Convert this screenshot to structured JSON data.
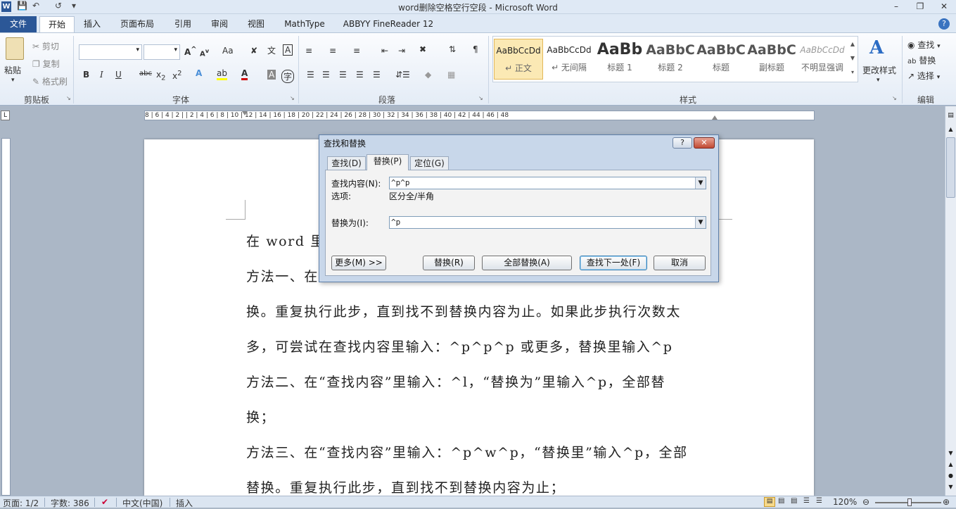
{
  "window": {
    "title": "word删除空格空行空段 - Microsoft Word"
  },
  "tabs": [
    "文件",
    "开始",
    "插入",
    "页面布局",
    "引用",
    "审阅",
    "视图",
    "MathType",
    "ABBYY FineReader 12"
  ],
  "clipboard": {
    "paste": "粘贴",
    "cut": "剪切",
    "copy": "复制",
    "format_painter": "格式刷",
    "group": "剪贴板"
  },
  "font": {
    "group": "字体",
    "aa": "Aa"
  },
  "paragraph": {
    "group": "段落"
  },
  "styles": {
    "group": "样式",
    "items": [
      {
        "sample": "AaBbCcDd",
        "name": "↵ 正文"
      },
      {
        "sample": "AaBbCcDd",
        "name": "↵ 无间隔"
      },
      {
        "sample": "AaBb",
        "name": "标题 1"
      },
      {
        "sample": "AaBbC",
        "name": "标题 2"
      },
      {
        "sample": "AaBbC",
        "name": "标题"
      },
      {
        "sample": "AaBbC",
        "name": "副标题"
      },
      {
        "sample": "AaBbCcDd",
        "name": "不明显强调"
      }
    ],
    "change_styles": "更改样式"
  },
  "editing": {
    "group": "编辑",
    "find": "查找",
    "replace": "替换",
    "select": "选择"
  },
  "ruler": {
    "numbers": "8 | 6 | 4 | 2 |   | 2 | 4 | 6 | 8 | 10 | 12 | 14 | 16 | 18 | 20 | 22 | 24 | 26 | 28 | 30 | 32 | 34 | 36 | 38 | 40 | 42 | 44 | 46 | 48"
  },
  "document": {
    "lines": [
      "在 word 里",
      "方法一、在",
      "换。重复执行此步，直到找不到替换内容为止。如果此步执行次数太",
      "多，可尝试在查找内容里输入：^p^p^p 或更多，替换里输入^p",
      "方法二、在“查找内容”里输入：^l，“替换为”里输入^p，全部替",
      "换；",
      "方法三、在“查找内容”里输入：^p^w^p，“替换里”输入^p，全部",
      "替换。重复执行此步，直到找不到替换内容为止；"
    ]
  },
  "dialog": {
    "title": "查找和替换",
    "help": "?",
    "tabs": [
      "查找(D)",
      "替换(P)",
      "定位(G)"
    ],
    "find_label": "查找内容(N):",
    "find_value": "^p^p",
    "options_label": "选项:",
    "options_value": "区分全/半角",
    "replace_label": "替换为(I):",
    "replace_value": "^p",
    "buttons": {
      "more": "更多(M) >>",
      "replace": "替换(R)",
      "replace_all": "全部替换(A)",
      "find_next": "查找下一处(F)",
      "cancel": "取消"
    }
  },
  "status": {
    "page": "页面: 1/2",
    "words": "字数: 386",
    "language": "中文(中国)",
    "mode": "插入",
    "zoom": "120%"
  },
  "colors": {
    "file_tab": "#2b5797",
    "font_color": "#d00000",
    "highlight": "#ffff00"
  }
}
